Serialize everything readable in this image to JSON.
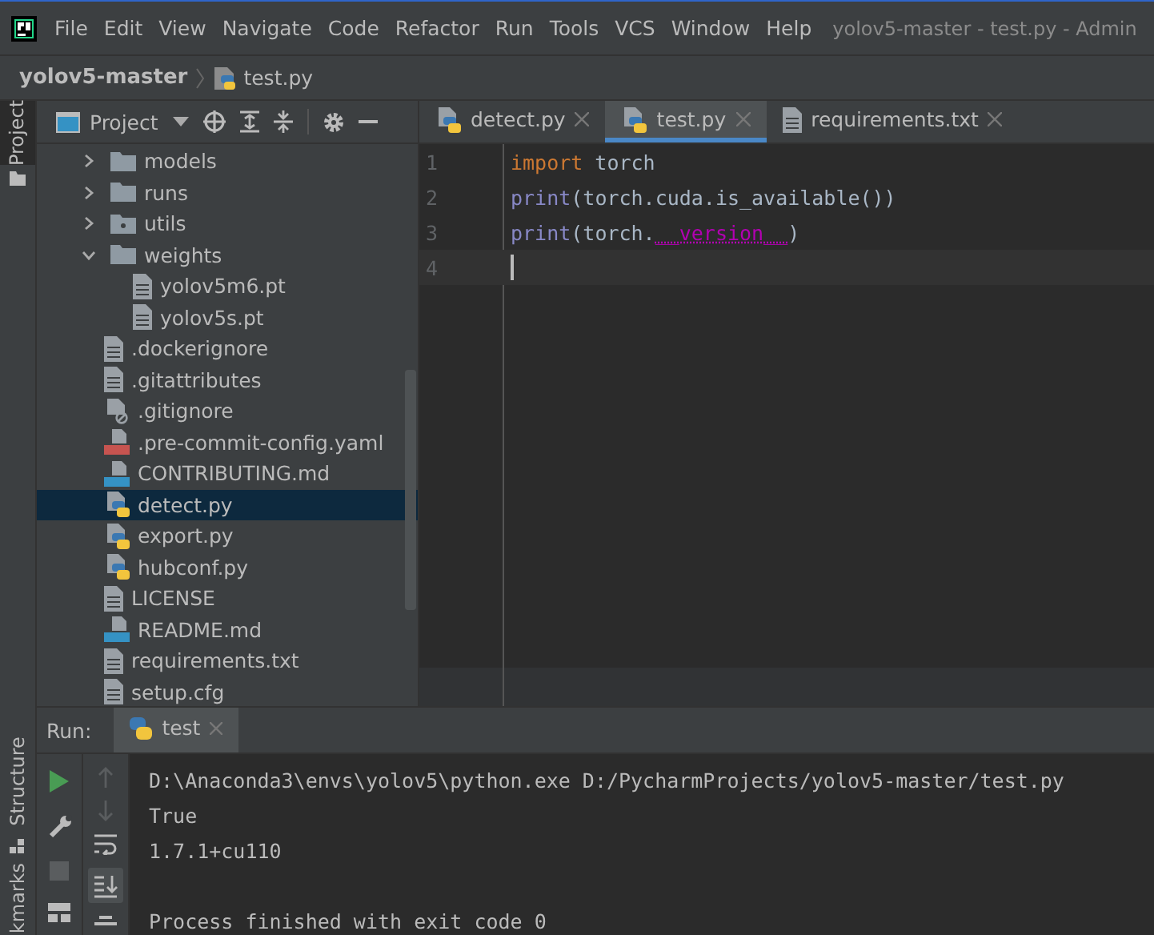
{
  "menu_bar": {
    "items": [
      "File",
      "Edit",
      "View",
      "Navigate",
      "Code",
      "Refactor",
      "Run",
      "Tools",
      "VCS",
      "Window",
      "Help"
    ],
    "window_title": "yolov5-master - test.py - Admin"
  },
  "breadcrumb": {
    "project": "yolov5-master",
    "file": "test.py"
  },
  "tool_stripe": {
    "top": "Project",
    "bottom": [
      "Structure",
      "kmarks"
    ]
  },
  "project_panel": {
    "title": "Project",
    "tree": [
      {
        "name": "models",
        "kind": "folder",
        "expanded": false
      },
      {
        "name": "runs",
        "kind": "folder",
        "expanded": false
      },
      {
        "name": "utils",
        "kind": "package",
        "expanded": false
      },
      {
        "name": "weights",
        "kind": "folder",
        "expanded": true,
        "children": [
          {
            "name": "yolov5m6.pt",
            "kind": "text",
            "selected": false
          },
          {
            "name": "yolov5s.pt",
            "kind": "text",
            "selected": false
          }
        ]
      },
      {
        "name": ".dockerignore",
        "kind": "text",
        "selected": false
      },
      {
        "name": ".gitattributes",
        "kind": "text",
        "selected": false
      },
      {
        "name": ".gitignore",
        "kind": "ignore",
        "selected": false
      },
      {
        "name": ".pre-commit-config.yaml",
        "kind": "yaml",
        "selected": false
      },
      {
        "name": "CONTRIBUTING.md",
        "kind": "markdown",
        "selected": false
      },
      {
        "name": "detect.py",
        "kind": "python",
        "selected": true
      },
      {
        "name": "export.py",
        "kind": "python",
        "selected": false
      },
      {
        "name": "hubconf.py",
        "kind": "python",
        "selected": false
      },
      {
        "name": "LICENSE",
        "kind": "text",
        "selected": false
      },
      {
        "name": "README.md",
        "kind": "markdown",
        "selected": false
      },
      {
        "name": "requirements.txt",
        "kind": "text",
        "selected": false
      },
      {
        "name": "setup.cfg",
        "kind": "text",
        "selected": false
      }
    ]
  },
  "editor": {
    "tabs": [
      {
        "label": "detect.py",
        "kind": "python",
        "selected": false
      },
      {
        "label": "test.py",
        "kind": "python",
        "selected": true
      },
      {
        "label": "requirements.txt",
        "kind": "text",
        "selected": false
      }
    ],
    "lines": [
      {
        "number": "1",
        "current": false,
        "tokens": [
          {
            "text": "import",
            "kind": "keyword"
          },
          {
            "text": " torch",
            "kind": "plain"
          }
        ]
      },
      {
        "number": "2",
        "current": false,
        "tokens": [
          {
            "text": "print",
            "kind": "builtin"
          },
          {
            "text": "(torch.cuda.is_available())",
            "kind": "plain"
          }
        ]
      },
      {
        "number": "3",
        "current": false,
        "tokens": [
          {
            "text": "print",
            "kind": "builtin"
          },
          {
            "text": "(torch.",
            "kind": "plain"
          },
          {
            "text": "__version__",
            "kind": "magic"
          },
          {
            "text": ")",
            "kind": "plain"
          }
        ]
      },
      {
        "number": "4",
        "current": true
      }
    ]
  },
  "run_panel": {
    "label": "Run:",
    "tabs": [
      {
        "label": "test",
        "selected": true
      }
    ],
    "output": [
      {
        "text": "D:\\Anaconda3\\envs\\yolov5\\python.exe D:/PycharmProjects/yolov5-master/test.py",
        "kind": "line"
      },
      {
        "text": "True",
        "kind": "line"
      },
      {
        "text": "1.7.1+cu110",
        "kind": "line"
      },
      {
        "text": "Process finished with exit code 0",
        "kind": "status"
      }
    ]
  }
}
